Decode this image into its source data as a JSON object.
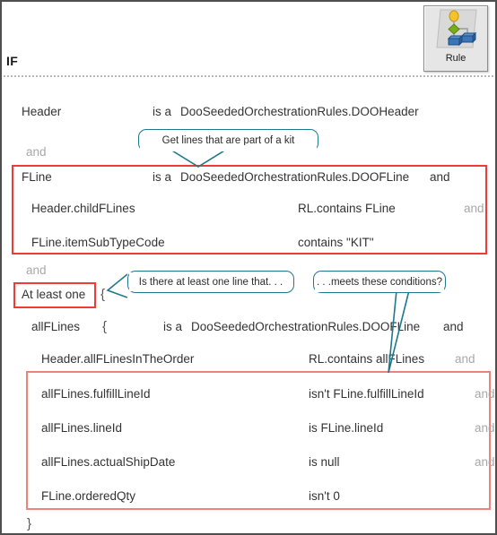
{
  "window": {
    "section_label": "IF",
    "rule_button": {
      "caption": "Rule",
      "icon": "rule-tree-icon",
      "node_colors": {
        "top": "#f2c230",
        "middle": "#7aab1e",
        "leaf": "#3a76b8"
      }
    }
  },
  "colors": {
    "highlight_box": "#ee3b33",
    "highlight_box_soft": "#f0827c",
    "callout_border": "#20788c",
    "text": "#333333",
    "conjunction_muted": "#a8a8a8"
  },
  "conditions": [
    {
      "id": "header",
      "subject": "Header",
      "operator": "is a",
      "value": "DooSeededOrchestrationRules.DOOHeader",
      "conjunction": ""
    },
    {
      "id": "and-1",
      "subject": "",
      "operator": "",
      "value": "",
      "conjunction": "and"
    },
    {
      "id": "fline",
      "subject": "FLine",
      "operator": "is a",
      "value": "DooSeededOrchestrationRules.DOOFLine",
      "conjunction": "and"
    },
    {
      "id": "header-childflines",
      "subject": "Header.childFLines",
      "operator": "RL.contains FLine",
      "value": "",
      "conjunction": "and"
    },
    {
      "id": "fline-itemsubtypecode",
      "subject": "FLine.itemSubTypeCode",
      "operator": "contains \"KIT\"",
      "value": "",
      "conjunction": ""
    },
    {
      "id": "and-2",
      "subject": "",
      "operator": "",
      "value": "",
      "conjunction": "and"
    },
    {
      "id": "at-least-one",
      "subject": "At least one",
      "operator": "",
      "value": "",
      "conjunction": "",
      "brace": "{"
    },
    {
      "id": "allflines",
      "subject": "allFLines",
      "brace": "{",
      "operator": "is a",
      "value": "DooSeededOrchestrationRules.DOOFLine",
      "conjunction": "and"
    },
    {
      "id": "header-allflinesintheorder",
      "subject": "Header.allFLinesInTheOrder",
      "operator": "RL.contains allFLines",
      "value": "",
      "conjunction": "and"
    },
    {
      "id": "allflines-fulfilllineid",
      "subject": "allFLines.fulfillLineId",
      "operator": "isn't FLine.fulfillLineId",
      "value": "",
      "conjunction": "and"
    },
    {
      "id": "allflines-lineid",
      "subject": "allFLines.lineId",
      "operator": "is FLine.lineId",
      "value": "",
      "conjunction": "and"
    },
    {
      "id": "allflines-actualshipdate",
      "subject": "allFLines.actualShipDate",
      "operator": "is null",
      "value": "",
      "conjunction": "and"
    },
    {
      "id": "fline-orderedqty",
      "subject": "FLine.orderedQty",
      "operator": "isn't 0",
      "value": "",
      "conjunction": ""
    },
    {
      "id": "close-brace",
      "subject": "}",
      "operator": "",
      "value": "",
      "conjunction": ""
    }
  ],
  "callouts": [
    {
      "id": "callout-kit",
      "text": "Get lines that are part of a kit"
    },
    {
      "id": "callout-at-least-one",
      "text": "Is there at least one line that. . ."
    },
    {
      "id": "callout-conditions",
      "text": ". . .meets these conditions?"
    }
  ]
}
